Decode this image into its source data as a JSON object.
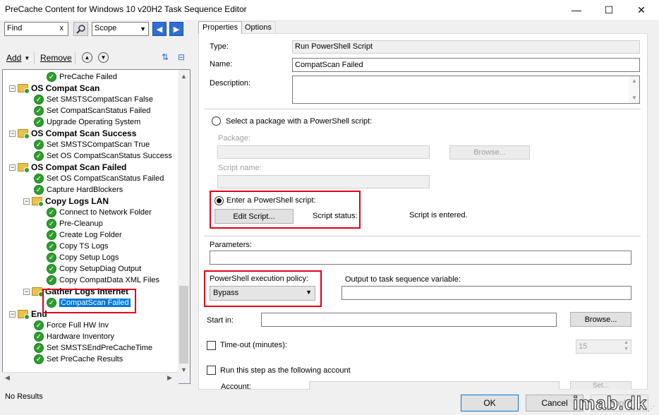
{
  "window": {
    "title": "PreCache Content for Windows 10 v20H2 Task Sequence Editor",
    "minimize": "—",
    "maximize": "☐",
    "close": "✕"
  },
  "toolbar": {
    "find_value": "Find",
    "find_clear": "x",
    "scope_value": "Scope",
    "add_label": "Add",
    "remove_label": "Remove"
  },
  "tree": [
    {
      "label": "PreCache Failed",
      "type": "step",
      "level": 2
    },
    {
      "label": "OS Compat Scan",
      "type": "group",
      "level": 0
    },
    {
      "label": "Set SMSTSCompatScan False",
      "type": "step",
      "level": 1
    },
    {
      "label": "Set CompatScanStatus Failed",
      "type": "step",
      "level": 1
    },
    {
      "label": "Upgrade Operating System",
      "type": "step",
      "level": 1
    },
    {
      "label": "OS Compat Scan Success",
      "type": "group",
      "level": 0
    },
    {
      "label": "Set SMSTSCompatScan True",
      "type": "step",
      "level": 1
    },
    {
      "label": "Set OS CompatScanStatus Success",
      "type": "step",
      "level": 1
    },
    {
      "label": "OS Compat Scan Failed",
      "type": "group",
      "level": 0
    },
    {
      "label": "Set OS CompatScanStatus Failed",
      "type": "step",
      "level": 1
    },
    {
      "label": "Capture HardBlockers",
      "type": "step",
      "level": 1
    },
    {
      "label": "Copy Logs LAN",
      "type": "group",
      "level": 1
    },
    {
      "label": "Connect to Network Folder",
      "type": "step",
      "level": 2
    },
    {
      "label": "Pre-Cleanup",
      "type": "step",
      "level": 2
    },
    {
      "label": "Create Log Folder",
      "type": "step",
      "level": 2
    },
    {
      "label": "Copy TS Logs",
      "type": "step",
      "level": 2
    },
    {
      "label": "Copy Setup Logs",
      "type": "step",
      "level": 2
    },
    {
      "label": "Copy SetupDiag Output",
      "type": "step",
      "level": 2
    },
    {
      "label": "Copy CompatData XML Files",
      "type": "step",
      "level": 2
    },
    {
      "label": "Gather Logs Internet",
      "type": "group",
      "level": 1
    },
    {
      "label": "CompatScan Failed",
      "type": "step",
      "level": 2,
      "selected": true
    },
    {
      "label": "End",
      "type": "group",
      "level": 0
    },
    {
      "label": "Force Full HW Inv",
      "type": "step",
      "level": 1
    },
    {
      "label": "Hardware Inventory",
      "type": "step",
      "level": 1
    },
    {
      "label": "Set SMSTSEndPreCacheTime",
      "type": "step",
      "level": 1
    },
    {
      "label": "Set PreCache Results",
      "type": "step",
      "level": 1
    }
  ],
  "status": {
    "text": "No Results"
  },
  "tabs": {
    "properties": "Properties",
    "options": "Options"
  },
  "props": {
    "type_label": "Type:",
    "type_value": "Run PowerShell Script",
    "name_label": "Name:",
    "name_value": "CompatScan Failed",
    "desc_label": "Description:",
    "opt_package": "Select a package with a PowerShell script:",
    "package_label": "Package:",
    "browse_disabled": "Browse...",
    "script_name_label": "Script name:",
    "opt_enter": "Enter a PowerShell script:",
    "edit_script": "Edit Script...",
    "script_status_label": "Script status:",
    "script_status_value": "Script is entered.",
    "parameters_label": "Parameters:",
    "policy_label": "PowerShell execution policy:",
    "policy_value": "Bypass",
    "output_label": "Output to task sequence variable:",
    "start_in_label": "Start in:",
    "browse": "Browse...",
    "timeout_label": "Time-out (minutes):",
    "timeout_value": "15",
    "run_as_label": "Run this step as the following account",
    "account_label": "Account:",
    "set_label": "Set..."
  },
  "buttons": {
    "ok": "OK",
    "cancel": "Cancel",
    "apply": "Apply"
  },
  "watermark": "imab.dk"
}
